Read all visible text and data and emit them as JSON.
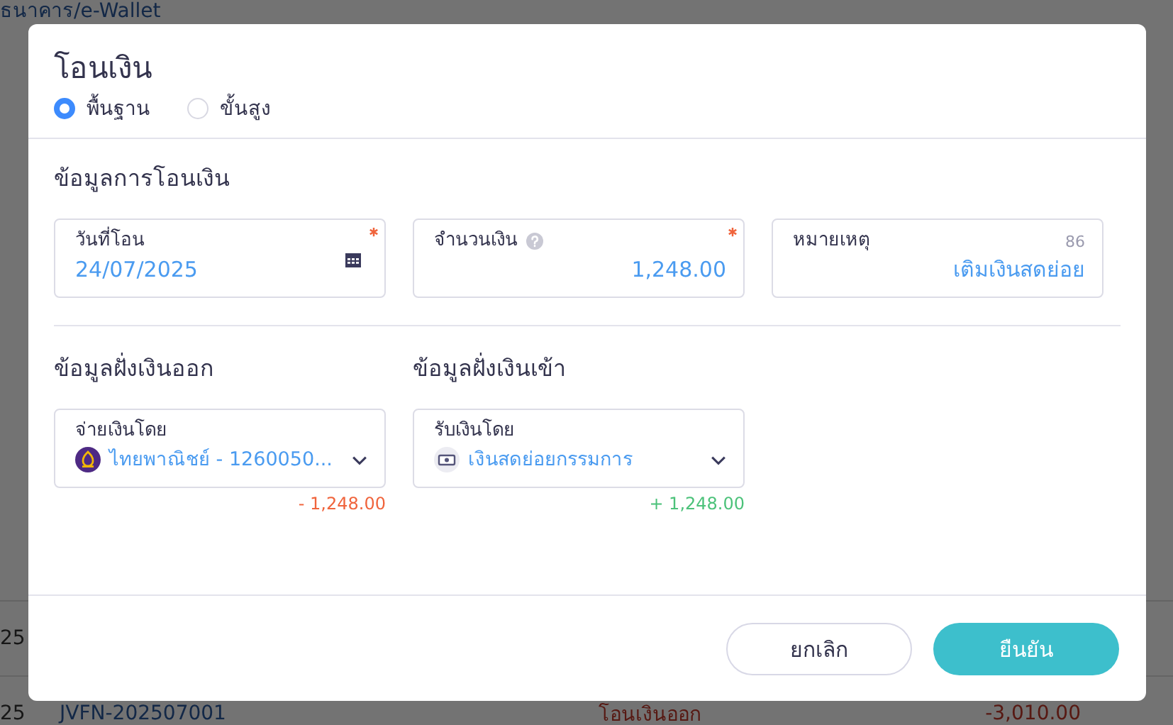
{
  "background": {
    "breadcrumb": "ธนาคาร/e-Wallet",
    "rows": [
      {
        "date": "25",
        "document": "",
        "type": "",
        "amount": ""
      },
      {
        "date": "25",
        "document": "JVFN-202507001",
        "type": "โอนเงินออก",
        "amount": "-3,010.00"
      }
    ]
  },
  "dialog": {
    "title": "โอนเงิน",
    "modes": [
      {
        "label": "พื้นฐาน",
        "selected": true
      },
      {
        "label": "ขั้นสูง",
        "selected": false
      }
    ],
    "section_title": "ข้อมูลการโอนเงิน",
    "fields": [
      {
        "kind": "date",
        "label": "วันที่โอน",
        "value": "24/07/2025",
        "required": true
      },
      {
        "kind": "amount",
        "label": "จำนวนเงิน",
        "value": "1,248.00",
        "required": true
      },
      {
        "kind": "note",
        "label": "หมายเหตุ",
        "value": "เติมเงินสดย่อย",
        "counter": "86",
        "required": false
      }
    ],
    "sides": [
      {
        "kind": "out",
        "heading": "ข้อมูลฝั่งเงินออก",
        "label": "จ่ายเงินโดย",
        "value": "ไทยพาณิชย์ - 1260050...",
        "amount": "- 1,248.00"
      },
      {
        "kind": "in",
        "heading": "ข้อมูลฝั่งเงินเข้า",
        "label": "รับเงินโดย",
        "value": "เงินสดย่อยกรรมการ",
        "amount": "+ 1,248.00"
      }
    ],
    "buttons": [
      {
        "kind": "secondary",
        "label": "ยกเลิก"
      },
      {
        "kind": "primary",
        "label": "ยืนยัน"
      }
    ]
  }
}
